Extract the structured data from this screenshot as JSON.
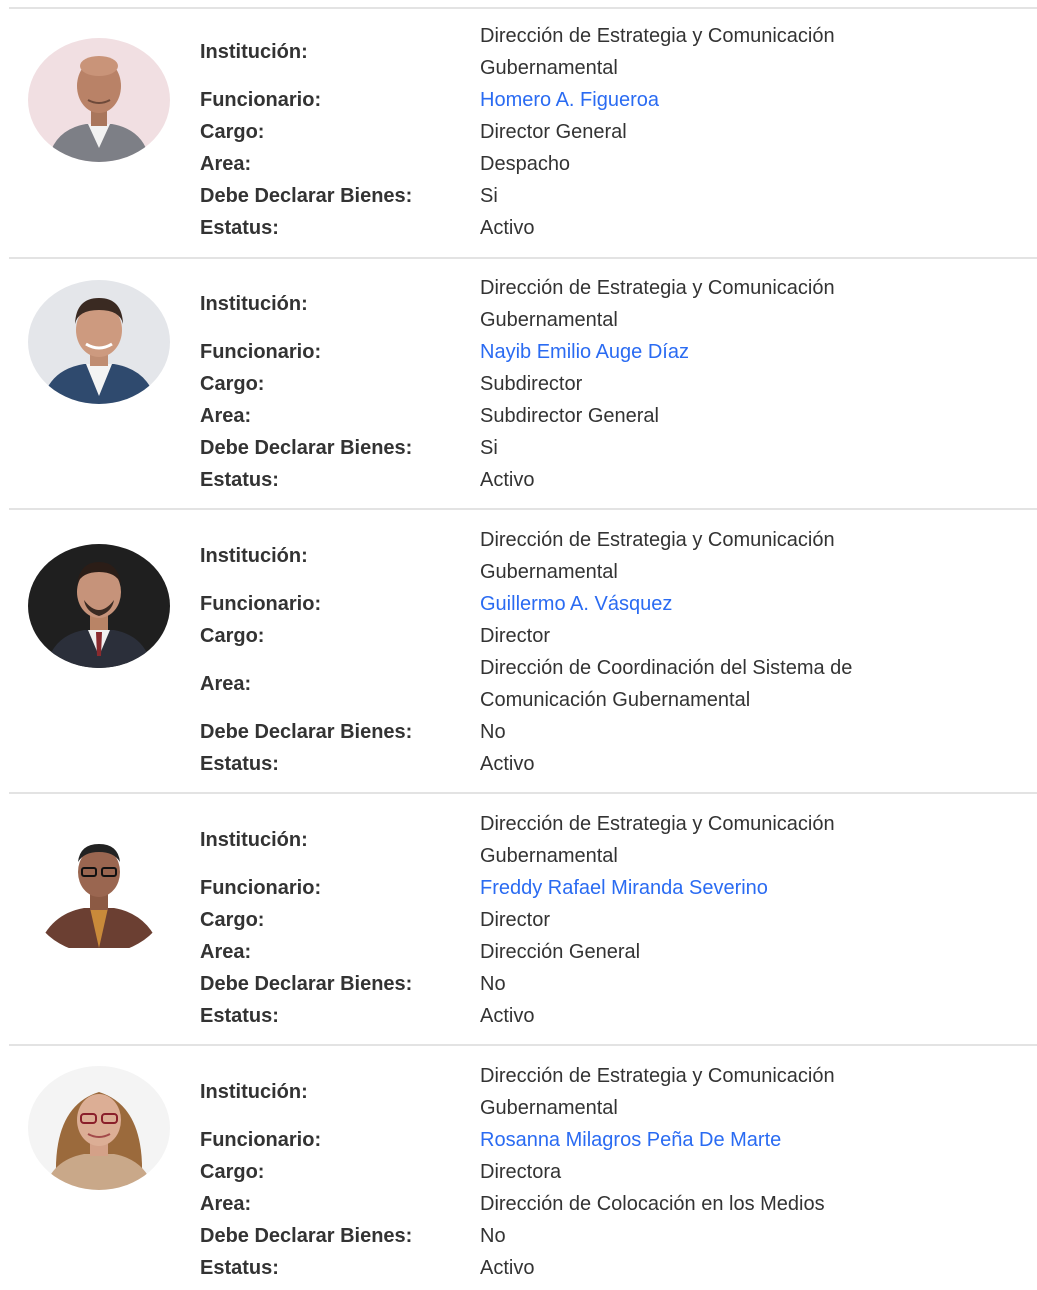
{
  "labels": {
    "institucion": "Institución:",
    "funcionario": "Funcionario:",
    "cargo": "Cargo:",
    "area": "Area:",
    "debe_declarar": "Debe Declarar Bienes:",
    "estatus": "Estatus:"
  },
  "colors": {
    "link": "#2a6bf2",
    "text": "#333333",
    "divider": "#e3e3e3"
  },
  "officials": [
    {
      "institucion_line1": "Dirección de Estrategia y Comunicación",
      "institucion_line2": "Gubernamental",
      "funcionario": "Homero A. Figueroa",
      "cargo": "Director General",
      "area_line1": "Despacho",
      "debe_declarar": "Si",
      "estatus": "Activo",
      "photo": "portrait-bald-man-pink-background"
    },
    {
      "institucion_line1": "Dirección de Estrategia y Comunicación",
      "institucion_line2": "Gubernamental",
      "funcionario": "Nayib Emilio Auge Díaz",
      "cargo": "Subdirector",
      "area_line1": "Subdirector General",
      "debe_declarar": "Si",
      "estatus": "Activo",
      "photo": "portrait-man-suit-light-background"
    },
    {
      "institucion_line1": "Dirección de Estrategia y Comunicación",
      "institucion_line2": "Gubernamental",
      "funcionario": "Guillermo A. Vásquez",
      "cargo": "Director",
      "area_line1": "Dirección de Coordinación del Sistema de",
      "area_line2": "Comunicación Gubernamental",
      "debe_declarar": "No",
      "estatus": "Activo",
      "photo": "portrait-man-dark-background"
    },
    {
      "institucion_line1": "Dirección de Estrategia y Comunicación",
      "institucion_line2": "Gubernamental",
      "funcionario": "Freddy Rafael Miranda Severino",
      "cargo": "Director",
      "area_line1": "Dirección General",
      "debe_declarar": "No",
      "estatus": "Activo",
      "photo": "portrait-man-white-background"
    },
    {
      "institucion_line1": "Dirección de Estrategia y Comunicación",
      "institucion_line2": "Gubernamental",
      "funcionario": "Rosanna Milagros Peña De Marte",
      "cargo": "Directora",
      "area_line1": "Dirección de Colocación en los Medios",
      "debe_declarar": "No",
      "estatus": "Activo",
      "photo": "portrait-woman-glasses-white-background"
    }
  ]
}
